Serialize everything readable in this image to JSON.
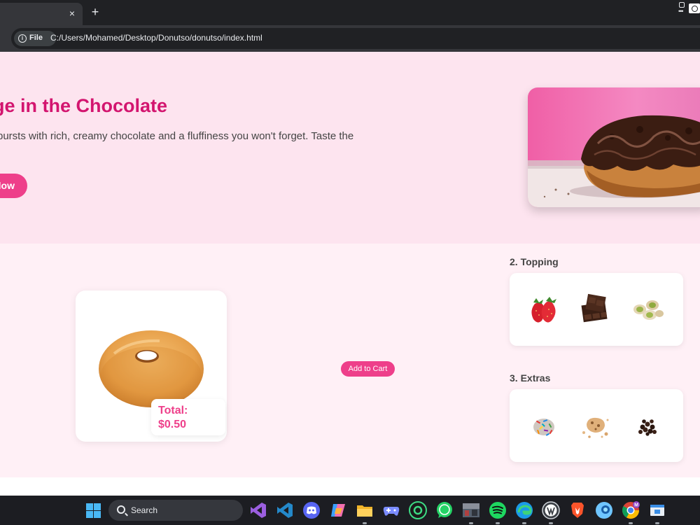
{
  "browser": {
    "tab_close_glyph": "×",
    "new_tab_glyph": "+",
    "site_chip_label": "File",
    "url": "C:/Users/Mohamed/Desktop/Donutso/donutso/index.html",
    "icons": [
      "info-icon",
      "close-icon",
      "plus-icon",
      "extension-icon",
      "camera-icon"
    ]
  },
  "hero": {
    "title": "ge in the Chocolate",
    "description": "bursts with rich, creamy chocolate and a fluffiness you won't forget. Taste the",
    "cta_label": "low",
    "image": "chocolate-donut-image"
  },
  "builder": {
    "total_label": "Total:",
    "total_value": "$0.50",
    "add_to_cart_label": "Add to Cart",
    "topping_heading": "2. Topping",
    "toppings": [
      "strawberry-image",
      "chocolate-bar-image",
      "pistachio-image"
    ],
    "extras_heading": "3. Extras",
    "extras": [
      "sprinkles-image",
      "cookie-crumbs-image",
      "chocolate-chips-image"
    ]
  },
  "taskbar": {
    "search_label": "Search",
    "apps": [
      "visual-studio-icon",
      "vscode-icon",
      "discord-icon",
      "copilot-icon",
      "file-explorer-icon",
      "game-controller-icon",
      "android-studio-icon",
      "whatsapp-icon",
      "game-thumbnail-icon",
      "spotify-icon",
      "edge-icon",
      "wordpress-icon",
      "brave-icon",
      "browser-icon",
      "chrome-icon",
      "app-window-icon"
    ]
  },
  "colors": {
    "brand_pink": "#ee3f8a",
    "title_magenta": "#d3156f",
    "hero_bg": "#fde4ef",
    "builder_bg": "#fff0f6"
  }
}
